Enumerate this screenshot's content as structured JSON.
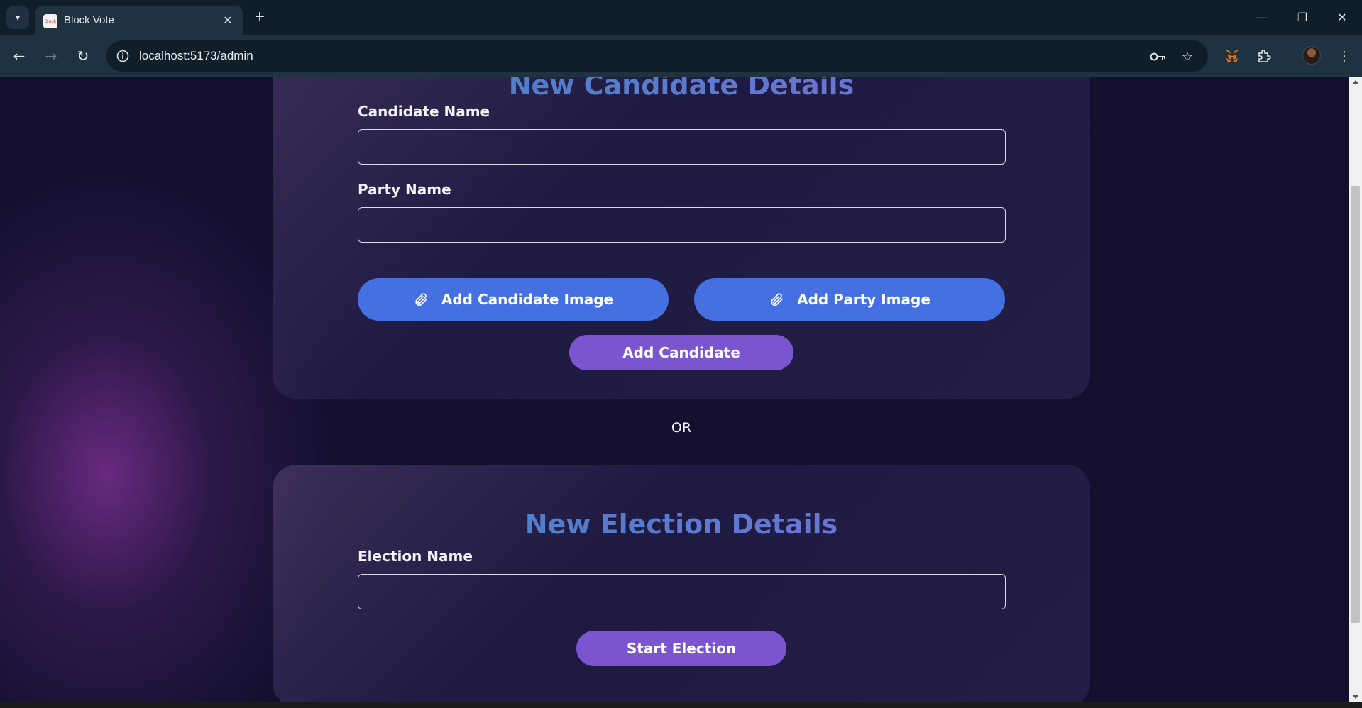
{
  "browser": {
    "tab_title": "Block Vote",
    "favicon_text": "Block",
    "url": "localhost:5173/admin"
  },
  "candidate_form": {
    "title": "New Candidate Details",
    "candidate_name_label": "Candidate Name",
    "candidate_name_value": "",
    "party_name_label": "Party Name",
    "party_name_value": "",
    "add_candidate_image_label": "Add Candidate Image",
    "add_party_image_label": "Add Party Image",
    "submit_label": "Add Candidate"
  },
  "divider": {
    "text": "OR"
  },
  "election_form": {
    "title": "New Election Details",
    "election_name_label": "Election Name",
    "election_name_value": "",
    "submit_label": "Start Election"
  },
  "colors": {
    "page_background": "#13102f",
    "upload_button": "#4470e2",
    "submit_button": "#7a55cf",
    "title_gradient_start": "#3d86c6",
    "title_gradient_end": "#7b6fd6"
  }
}
